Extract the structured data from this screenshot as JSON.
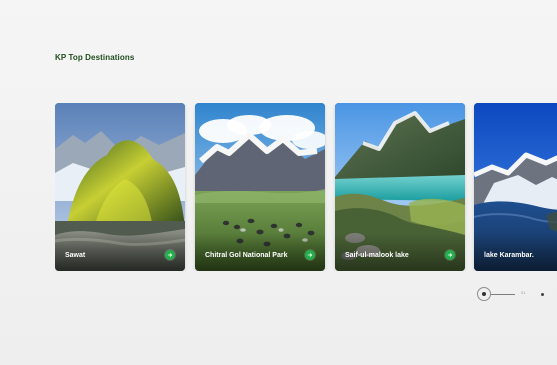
{
  "section": {
    "title": "KP Top Destinations"
  },
  "destinations": [
    {
      "name": "Sawat",
      "icon": "arrow-right-icon"
    },
    {
      "name": "Chitral Gol National Park",
      "icon": "arrow-right-icon"
    },
    {
      "name": "Saif-ul-malook lake",
      "icon": "arrow-right-icon"
    },
    {
      "name": "lake Karambar.",
      "icon": "arrow-right-icon"
    }
  ],
  "pagination": {
    "page_count": "01"
  },
  "colors": {
    "title": "#1e4d1e",
    "accent": "#22b14c",
    "background": "#f3f3f3"
  }
}
